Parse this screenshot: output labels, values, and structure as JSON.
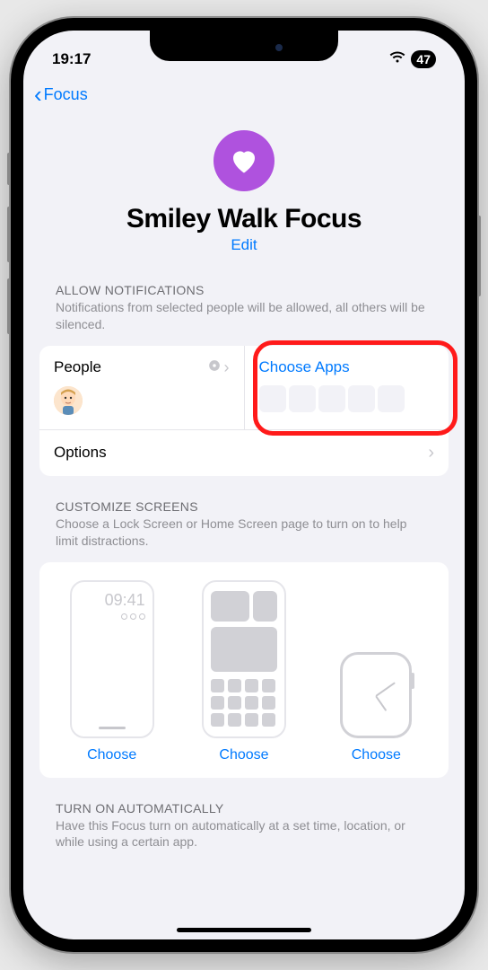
{
  "statusBar": {
    "time": "19:17",
    "battery": "47"
  },
  "nav": {
    "back": "Focus"
  },
  "header": {
    "title": "Smiley Walk Focus",
    "edit": "Edit"
  },
  "notifications": {
    "sectionTitle": "ALLOW NOTIFICATIONS",
    "sectionDesc": "Notifications from selected people will be allowed, all others will be silenced.",
    "peopleLabel": "People",
    "appsLabel": "Choose Apps",
    "optionsLabel": "Options"
  },
  "customize": {
    "sectionTitle": "CUSTOMIZE SCREENS",
    "sectionDesc": "Choose a Lock Screen or Home Screen page to turn on to help limit distractions.",
    "lockTime": "09:41",
    "choose": "Choose"
  },
  "auto": {
    "sectionTitle": "TURN ON AUTOMATICALLY",
    "sectionDesc": "Have this Focus turn on automatically at a set time, location, or while using a certain app."
  }
}
